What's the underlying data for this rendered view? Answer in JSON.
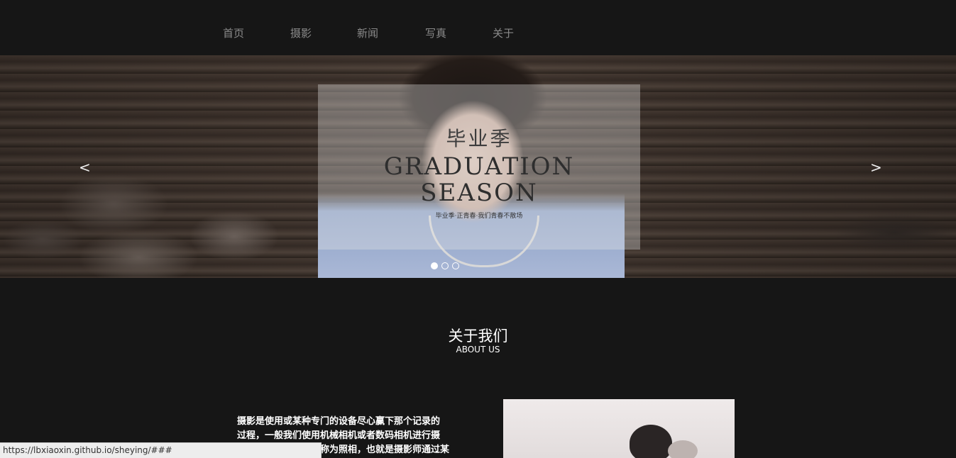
{
  "nav": {
    "items": [
      "首页",
      "摄影",
      "新闻",
      "写真",
      "关于"
    ]
  },
  "hero": {
    "caption_cn": "毕业季",
    "caption_en_line1": "GRADUATION",
    "caption_en_line2": "SEASON",
    "caption_small": "毕业季·正青春·我们青春不散场",
    "prev_arrow": "<",
    "next_arrow": ">",
    "slides_total": 3,
    "active_slide": 1
  },
  "about": {
    "title": "关于我们",
    "subtitle": "ABOUT US",
    "text_line1": "摄影是使用或某种专门的设备尽心赢下那个记录的",
    "text_line2": "过程，一般我们使用机械相机或者数码相机进行摄",
    "text_line3": "影。有时摄影也会被称为照相，也就是摄影师通过某"
  },
  "status": {
    "url": "https://lbxiaoxin.github.io/sheying/###"
  },
  "colors": {
    "background": "#161616",
    "nav_text": "#8a8a8a",
    "text": "#ffffff"
  }
}
